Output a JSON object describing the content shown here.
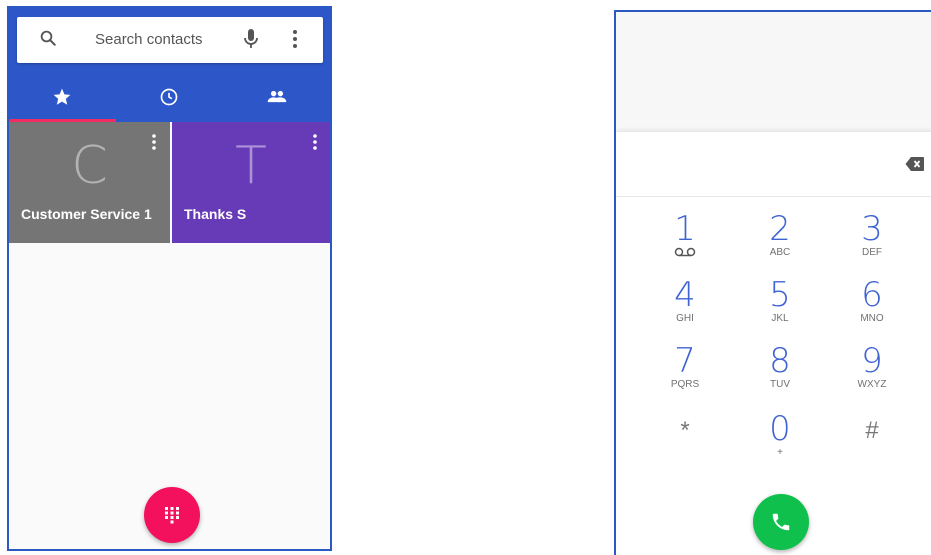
{
  "contacts_screen": {
    "search": {
      "placeholder": "Search contacts"
    },
    "tabs": [
      {
        "name": "Favorites",
        "icon": "star-icon"
      },
      {
        "name": "Recents",
        "icon": "clock-icon"
      },
      {
        "name": "Contacts",
        "icon": "people-icon"
      }
    ],
    "favorites": [
      {
        "letter": "C",
        "name": "Customer Service 1",
        "color": "#757575"
      },
      {
        "letter": "T",
        "name": "Thanks S",
        "color": "#673ab7"
      }
    ],
    "colors": {
      "appbar": "#2d57c9",
      "accent": "#f3115e"
    }
  },
  "dialer_screen": {
    "keys": [
      {
        "digit": "1",
        "letters": ""
      },
      {
        "digit": "2",
        "letters": "ABC"
      },
      {
        "digit": "3",
        "letters": "DEF"
      },
      {
        "digit": "4",
        "letters": "GHI"
      },
      {
        "digit": "5",
        "letters": "JKL"
      },
      {
        "digit": "6",
        "letters": "MNO"
      },
      {
        "digit": "7",
        "letters": "PQRS"
      },
      {
        "digit": "8",
        "letters": "TUV"
      },
      {
        "digit": "9",
        "letters": "WXYZ"
      },
      {
        "digit": "*",
        "letters": ""
      },
      {
        "digit": "0",
        "letters": "+"
      },
      {
        "digit": "#",
        "letters": ""
      }
    ],
    "colors": {
      "digit": "#3e63d2",
      "call": "#10c04c"
    }
  }
}
